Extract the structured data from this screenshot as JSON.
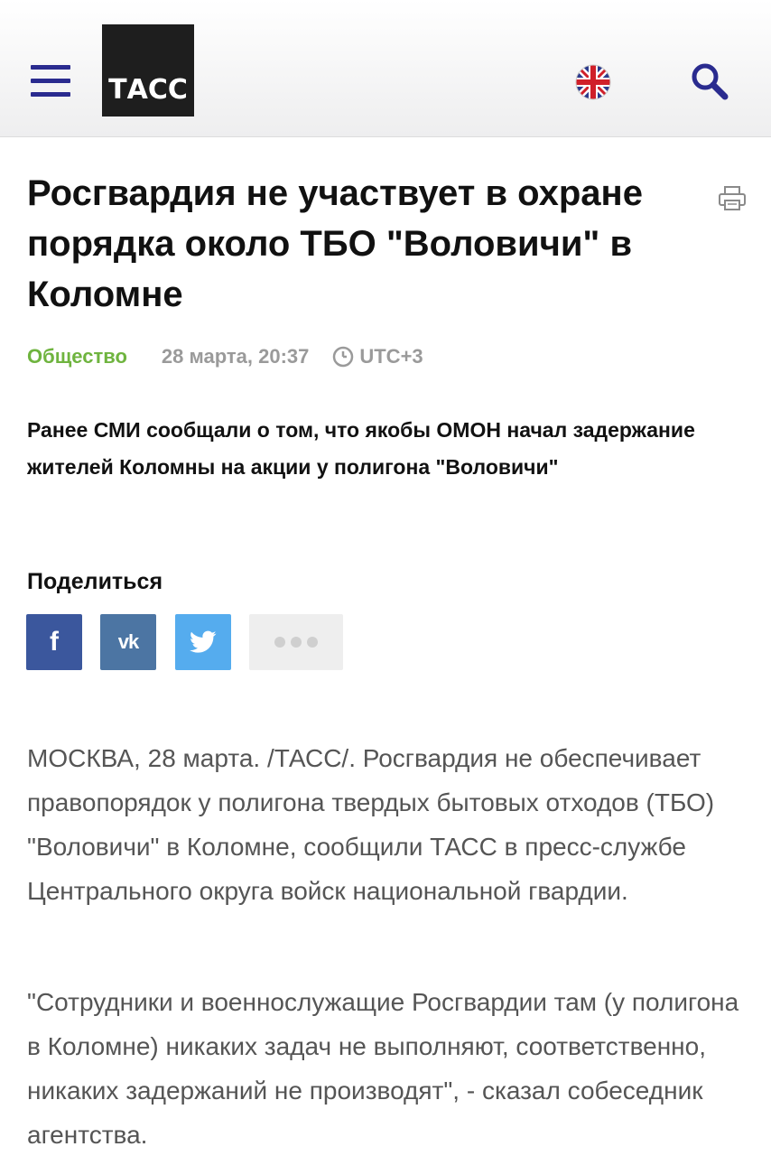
{
  "header": {
    "logo_text": "ТАСС",
    "menu_icon": "hamburger-icon",
    "language_icon": "uk-flag-icon",
    "search_icon": "search-icon",
    "brand_color": "#2a2b8f"
  },
  "article": {
    "title": "Росгвардия не участвует в охране порядка около ТБО \"Воловичи\" в Коломне",
    "category": "Общество",
    "date": "28 марта, 20:37",
    "timezone": "UTC+3",
    "lead": "Ранее СМИ сообщали о том, что якобы ОМОН начал задержание жителей Коломны на акции у полигона \"Воловичи\"",
    "paragraphs": [
      "МОСКВА, 28 марта. /ТАСС/. Росгвардия не обеспечивает правопорядок у полигона твердых бытовых отходов (ТБО) \"Воловичи\" в Коломне, сообщили ТАСС в пресс-службе Центрального округа войск национальной гвардии.",
      "\"Сотрудники и военнослужащие Росгвардии там (у полигона в Коломне) никаких задач не выполняют, соответственно, никаких задержаний не производят\", - сказал собеседник агентства."
    ],
    "category_color": "#6fb43f"
  },
  "share": {
    "label": "Поделиться",
    "buttons": [
      {
        "name": "facebook",
        "glyph": "f",
        "color": "#3b579d"
      },
      {
        "name": "vk",
        "glyph": "vk",
        "color": "#4c75a3"
      },
      {
        "name": "twitter",
        "icon": "twitter-bird-icon",
        "color": "#55acee"
      },
      {
        "name": "more",
        "icon": "more-dots-icon",
        "color": "#eeeeee"
      }
    ]
  }
}
